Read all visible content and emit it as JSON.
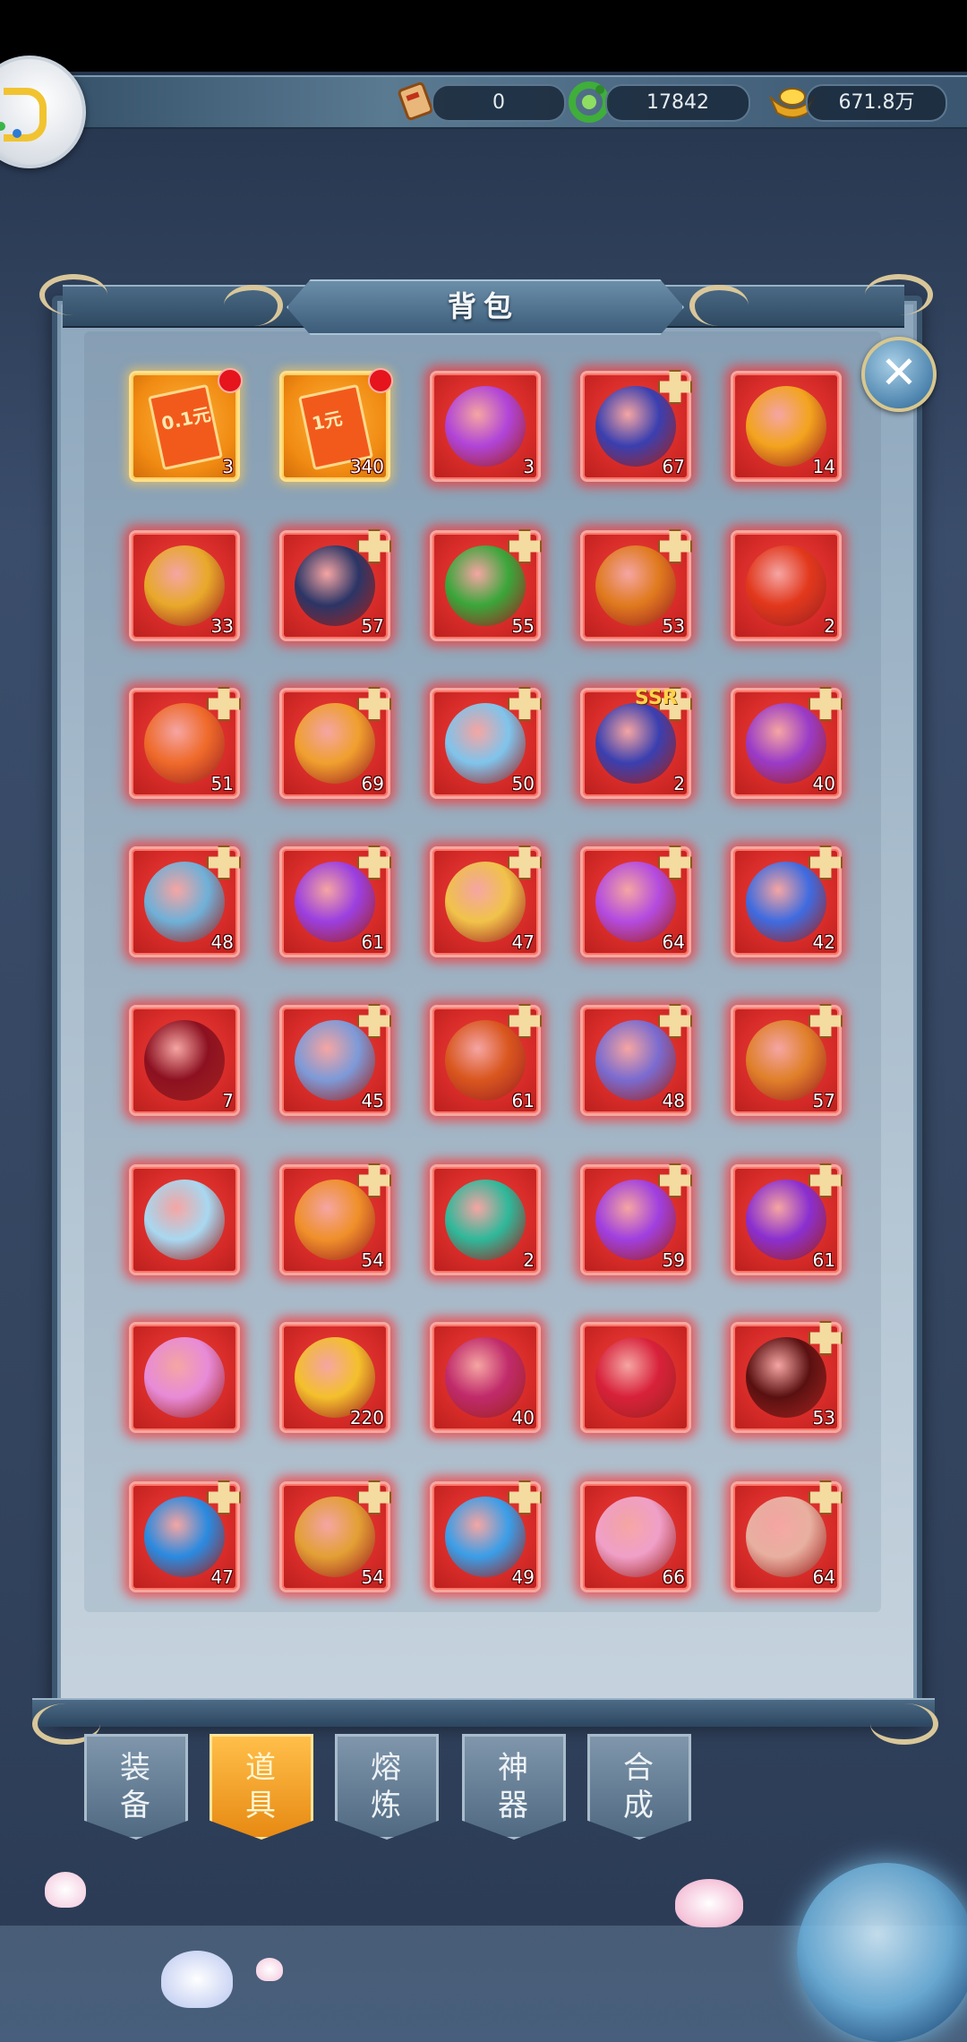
{
  "top_bar": {
    "currencies": [
      {
        "icon": "scroll-ticket-icon",
        "value": "0"
      },
      {
        "icon": "jade-dragon-icon",
        "value": "17842"
      },
      {
        "icon": "gold-ingot-icon",
        "value": "671.8万"
      }
    ]
  },
  "panel": {
    "title": "背包"
  },
  "items": [
    {
      "icon": "red-envelope-icon",
      "count": "3",
      "label": "0.1元",
      "style": "gold",
      "reddot": true
    },
    {
      "icon": "red-envelope-icon",
      "count": "340",
      "label": "1元",
      "style": "gold",
      "reddot": true
    },
    {
      "icon": "purple-orb-icon",
      "count": "3",
      "color": "#b044d8"
    },
    {
      "icon": "armor-icon",
      "count": "67",
      "plus": true,
      "color": "#3a3fb0"
    },
    {
      "icon": "talisman-icon",
      "count": "14",
      "color": "#f3a41e"
    },
    {
      "icon": "hammer-icon",
      "count": "33",
      "color": "#e8a92a"
    },
    {
      "icon": "robe-icon",
      "count": "57",
      "plus": true,
      "color": "#2b3566"
    },
    {
      "icon": "turtle-icon",
      "count": "55",
      "plus": true,
      "color": "#3aa63a"
    },
    {
      "icon": "phoenix-wings-icon",
      "count": "53",
      "plus": true,
      "color": "#e07a1e"
    },
    {
      "icon": "flame-orb-icon",
      "count": "2",
      "color": "#e2381c"
    },
    {
      "icon": "dress-icon",
      "count": "51",
      "plus": true,
      "color": "#ef6a2a"
    },
    {
      "icon": "sun-medallion-icon",
      "count": "69",
      "plus": true,
      "color": "#f0a02e"
    },
    {
      "icon": "wings-icon",
      "count": "50",
      "plus": true,
      "color": "#7fc4ec"
    },
    {
      "icon": "armor-icon",
      "count": "2",
      "plus": true,
      "ssr": "SSR",
      "color": "#3a3fb0"
    },
    {
      "icon": "sword-icon",
      "count": "40",
      "plus": true,
      "color": "#9a3bc8"
    },
    {
      "icon": "blade-icon",
      "count": "48",
      "plus": true,
      "color": "#6fb0d8"
    },
    {
      "icon": "magic-circle-icon",
      "count": "61",
      "plus": true,
      "color": "#9b3fe0"
    },
    {
      "icon": "golden-sword-icon",
      "count": "47",
      "plus": true,
      "color": "#f1c34a"
    },
    {
      "icon": "purple-spirit-icon",
      "count": "64",
      "plus": true,
      "color": "#b44be0"
    },
    {
      "icon": "blue-phoenix-icon",
      "count": "42",
      "plus": true,
      "color": "#3f6be0"
    },
    {
      "icon": "crimson-orb-icon",
      "count": "7",
      "color": "#8c1020"
    },
    {
      "icon": "mech-spirit-icon",
      "count": "45",
      "plus": true,
      "color": "#7d9ad8"
    },
    {
      "icon": "fire-demon-icon",
      "count": "61",
      "plus": true,
      "color": "#d9561e"
    },
    {
      "icon": "great-sword-icon",
      "count": "48",
      "plus": true,
      "color": "#7a6bd0"
    },
    {
      "icon": "fire-lantern-icon",
      "count": "57",
      "plus": true,
      "color": "#e0802a"
    },
    {
      "icon": "ice-dragon-icon",
      "count": "",
      "color": "#a8d8f0"
    },
    {
      "icon": "fire-scroll-icon",
      "count": "54",
      "plus": true,
      "color": "#f0902a"
    },
    {
      "icon": "emerald-gem-icon",
      "count": "2",
      "color": "#2fb89a"
    },
    {
      "icon": "violet-sigil-icon",
      "count": "59",
      "plus": true,
      "color": "#a03fe0"
    },
    {
      "icon": "void-flame-icon",
      "count": "61",
      "plus": true,
      "color": "#8a2fd0"
    },
    {
      "icon": "pink-crystal-icon",
      "count": "",
      "color": "#e88bd8"
    },
    {
      "icon": "golden-egg-icon",
      "count": "220",
      "color": "#f4c02c"
    },
    {
      "icon": "dark-gem-icon",
      "count": "40",
      "color": "#c02a6a"
    },
    {
      "icon": "ruby-icon",
      "count": "",
      "color": "#d8213a"
    },
    {
      "icon": "ink-beast-icon",
      "count": "53",
      "plus": true,
      "color": "#5a1010"
    },
    {
      "icon": "blue-mask-icon",
      "count": "47",
      "plus": true,
      "color": "#2a8ae0"
    },
    {
      "icon": "rune-circle-icon",
      "count": "54",
      "plus": true,
      "color": "#e3a035"
    },
    {
      "icon": "firework-icon",
      "count": "49",
      "plus": true,
      "color": "#3a9ee8"
    },
    {
      "icon": "balloons-icon",
      "count": "66",
      "color": "#f0a0c8"
    },
    {
      "icon": "seal-circle-icon",
      "count": "64",
      "plus": true,
      "color": "#e8b0a0"
    }
  ],
  "tabs": [
    {
      "label1": "装",
      "label2": "备",
      "active": false
    },
    {
      "label1": "道",
      "label2": "具",
      "active": true,
      "reddot": true
    },
    {
      "label1": "熔",
      "label2": "炼",
      "active": false
    },
    {
      "label1": "神",
      "label2": "器",
      "active": false
    },
    {
      "label1": "合",
      "label2": "成",
      "active": false
    }
  ],
  "close_icon": "close-icon"
}
